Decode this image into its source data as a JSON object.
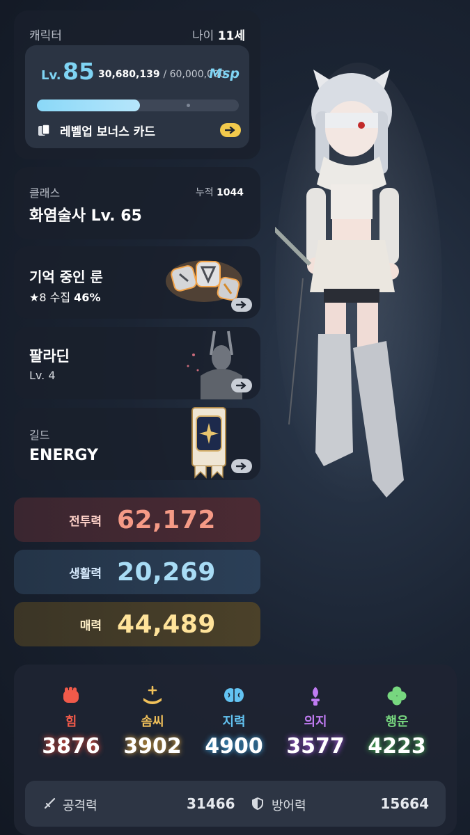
{
  "character": {
    "label": "캐릭터",
    "age_prefix": "나이",
    "age_value": "11세",
    "level_prefix": "Lv.",
    "level_value": "85",
    "exp_current": "30,680,139",
    "exp_max": "/ 60,000,000",
    "exp_fraction": 0.511,
    "currency": "Msp",
    "bonus_card_label": "레벨업 보너스 카드"
  },
  "class_info": {
    "label": "클래스",
    "accumulated_label": "누적",
    "accumulated_value": "1044",
    "value": "화염술사 Lv. 65"
  },
  "rune": {
    "title": "기억 중인 룬",
    "stars": "★8",
    "collect_label": "수집",
    "collect_percent": "46%"
  },
  "title_info": {
    "name": "팔라딘",
    "level": "Lv. 4"
  },
  "guild": {
    "label": "길드",
    "name": "ENERGY"
  },
  "power": {
    "combat_label": "전투력",
    "combat_value": "62,172",
    "life_label": "생활력",
    "life_value": "20,269",
    "charm_label": "매력",
    "charm_value": "44,489"
  },
  "stats": [
    {
      "name": "힘",
      "value": "3876",
      "icon": "fist-icon",
      "color": "#f05a4a"
    },
    {
      "name": "솜씨",
      "value": "3902",
      "icon": "hand-sparkle-icon",
      "color": "#f1c15a"
    },
    {
      "name": "지력",
      "value": "4900",
      "icon": "brain-icon",
      "color": "#63c3f2"
    },
    {
      "name": "의지",
      "value": "3577",
      "icon": "torch-icon",
      "color": "#c07bf2"
    },
    {
      "name": "행운",
      "value": "4223",
      "icon": "clover-icon",
      "color": "#77d77f"
    }
  ],
  "combat_stats": {
    "attack_label": "공격력",
    "attack_value": "31466",
    "defense_label": "방어력",
    "defense_value": "15664"
  },
  "icons": [
    "card-stack-icon",
    "arrow-right-icon",
    "sword-icon",
    "shield-icon",
    "rune-stones",
    "paladin-emblem",
    "guild-banner"
  ]
}
